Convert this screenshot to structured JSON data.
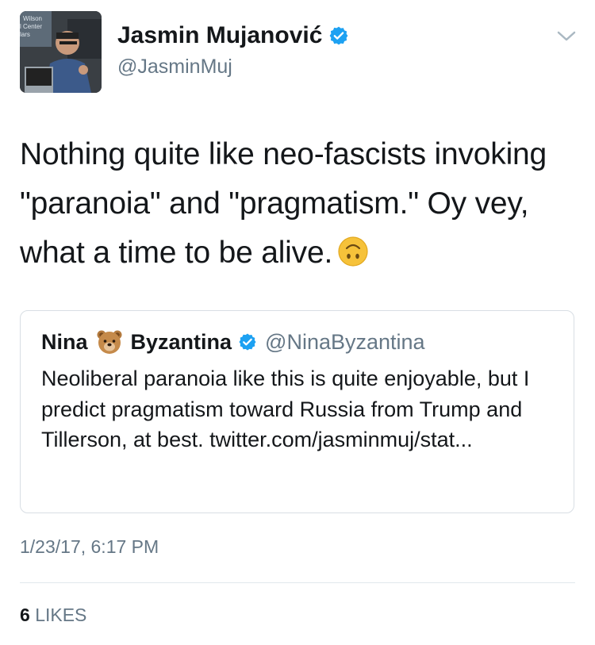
{
  "author": {
    "name": "Jasmin Mujanović",
    "handle": "@JasminMuj",
    "avatar_caption": "Wilson Center lars"
  },
  "tweet": {
    "text": "Nothing quite like neo-fascists invoking \"paranoia\" and \"pragmatism.\" Oy vey, what a time to be alive.",
    "emoji": "upside-down-face"
  },
  "quoted_tweet": {
    "name_first": "Nina",
    "name_emoji": "bear-face",
    "name_last": "Byzantina",
    "handle": "@NinaByzantina",
    "text": "Neoliberal paranoia like this is quite enjoyable, but I predict pragmatism toward Russia from Trump and Tillerson, at best. twitter.com/jasminmuj/stat..."
  },
  "meta": {
    "timestamp": "1/23/17, 6:17 PM",
    "likes_count": "6",
    "likes_label": "LIKES"
  },
  "colors": {
    "verified": "#1da1f2",
    "secondary_text": "#657786",
    "border": "#d8dee4"
  },
  "icons": {
    "verified": "verified-badge-icon",
    "menu": "chevron-down-icon"
  }
}
